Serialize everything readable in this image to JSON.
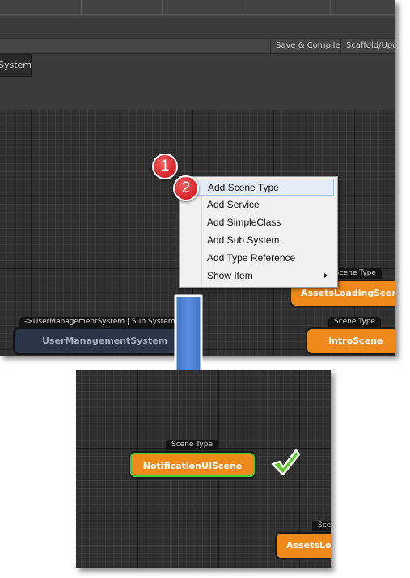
{
  "toolbar": {
    "save_compile_label": "Save & Compile",
    "scaffold_label": "Scaffold/Upd"
  },
  "tabs": {
    "system_label": "System"
  },
  "context_menu": {
    "items": [
      {
        "label": "Add Scene Type",
        "highlighted": true
      },
      {
        "label": "Add Service"
      },
      {
        "label": "Add SimpleClass"
      },
      {
        "label": "Add Sub System"
      },
      {
        "label": "Add Type Reference"
      },
      {
        "label": "Show Item",
        "has_submenu": true
      }
    ]
  },
  "badges": {
    "step1": "1",
    "step2": "2"
  },
  "canvas_top": {
    "assets_node": {
      "tag": "Scene Type",
      "title": "AssetsLoadingScene"
    },
    "intro_node": {
      "tag": "Scene Type",
      "title": "IntroScene"
    },
    "user_mgmt_node": {
      "tag": "->UserManagementSystem | Sub System",
      "title": "UserManagementSystem"
    }
  },
  "canvas_bottom": {
    "new_node": {
      "tag": "Scene Type",
      "title": "NotificationUIScene"
    },
    "assets_node": {
      "tag": "Scene Type",
      "title": "AssetsLoadingScene"
    }
  },
  "colors": {
    "node_orange": "#ef8a1a",
    "selection_outline": "#42d23a",
    "arrow_blue": "#3e6fc4",
    "badge_red": "#d4232a",
    "checkmark_green": "#5ec42c"
  },
  "icons": {
    "flow_arrow": "arrow-down-icon",
    "success": "checkmark-icon"
  }
}
